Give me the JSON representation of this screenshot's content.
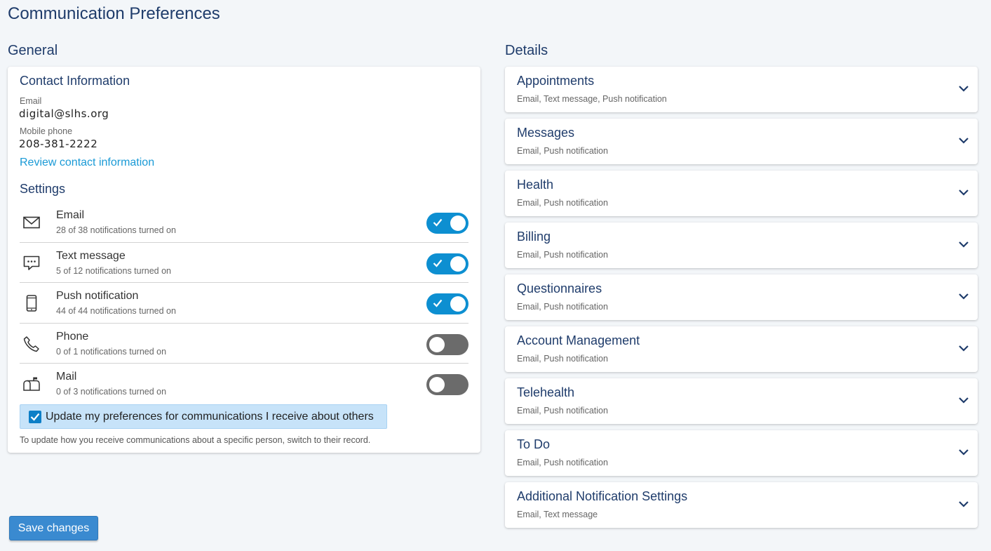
{
  "page": {
    "title": "Communication Preferences"
  },
  "general": {
    "heading": "General",
    "contact": {
      "heading": "Contact Information",
      "email_label": "Email",
      "email_value": "digital@slhs.org",
      "phone_label": "Mobile phone",
      "phone_value": "208-381-2222",
      "review_link": "Review contact information"
    },
    "settings": {
      "heading": "Settings",
      "items": [
        {
          "name": "Email",
          "status": "28 of 38 notifications turned on",
          "enabled": true,
          "icon": "envelope-icon"
        },
        {
          "name": "Text message",
          "status": "5 of 12 notifications turned on",
          "enabled": true,
          "icon": "chat-bubble-icon"
        },
        {
          "name": "Push notification",
          "status": "44 of 44 notifications turned on",
          "enabled": true,
          "icon": "mobile-phone-icon"
        },
        {
          "name": "Phone",
          "status": "0 of 1 notifications turned on",
          "enabled": false,
          "icon": "phone-handset-icon"
        },
        {
          "name": "Mail",
          "status": "0 of 3 notifications turned on",
          "enabled": false,
          "icon": "mailbox-icon"
        }
      ]
    },
    "others": {
      "label": "Update my preferences for communications I receive about others",
      "checked": true,
      "note": "To update how you receive communications about a specific person, switch to their record."
    }
  },
  "details": {
    "heading": "Details",
    "items": [
      {
        "title": "Appointments",
        "channels": "Email, Text message, Push notification"
      },
      {
        "title": "Messages",
        "channels": "Email, Push notification"
      },
      {
        "title": "Health",
        "channels": "Email, Push notification"
      },
      {
        "title": "Billing",
        "channels": "Email, Push notification"
      },
      {
        "title": "Questionnaires",
        "channels": "Email, Push notification"
      },
      {
        "title": "Account Management",
        "channels": "Email, Push notification"
      },
      {
        "title": "Telehealth",
        "channels": "Email, Push notification"
      },
      {
        "title": "To Do",
        "channels": "Email, Push notification"
      },
      {
        "title": "Additional Notification Settings",
        "channels": "Email, Text message"
      }
    ]
  },
  "actions": {
    "save_label": "Save changes"
  },
  "colors": {
    "heading": "#1f3c6b",
    "toggle_on": "#0d8fd1",
    "toggle_off": "#6b6b6b",
    "link": "#1a9ad6",
    "button": "#3a8ad0"
  }
}
